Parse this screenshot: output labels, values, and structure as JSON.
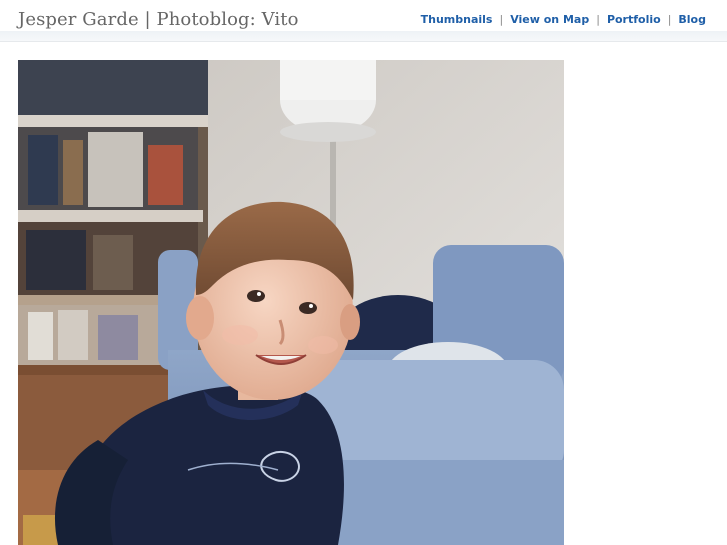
{
  "header": {
    "title": "Jesper Garde | Photoblog: Vito"
  },
  "nav": {
    "items": [
      {
        "label": "Thumbnails"
      },
      {
        "label": "View on Map"
      },
      {
        "label": "Portfolio"
      },
      {
        "label": "Blog"
      }
    ],
    "separator": "|"
  },
  "photo": {
    "subject": "child in navy sweater on blue sofa"
  },
  "colors": {
    "link": "#1f5fa8",
    "title": "#666666"
  }
}
